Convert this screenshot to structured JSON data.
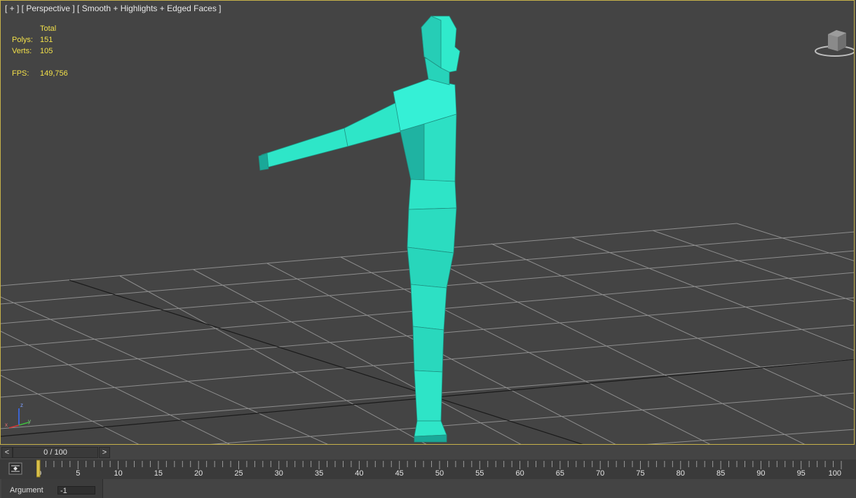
{
  "viewport": {
    "label": "[ + ] [ Perspective ] [ Smooth + Highlights + Edged Faces ]",
    "stats": {
      "header": "Total",
      "polys_label": "Polys:",
      "polys_value": "151",
      "verts_label": "Verts:",
      "verts_value": "105",
      "fps_label": "FPS:",
      "fps_value": "149,756"
    },
    "axes": {
      "x": "x",
      "y": "y",
      "z": "z"
    },
    "colors": {
      "background": "#444444",
      "grid": "#9a9a9a",
      "model": "#2fe6c8",
      "stats_text": "#f2e04a"
    }
  },
  "time_slider": {
    "prev_label": "<",
    "next_label": ">",
    "frame_display": "0 / 100"
  },
  "track_bar": {
    "ticks": [
      "0",
      "5",
      "10",
      "15",
      "20",
      "25",
      "30",
      "35",
      "40",
      "45",
      "50",
      "55",
      "60",
      "65",
      "70",
      "75",
      "80",
      "85",
      "90",
      "95",
      "100"
    ]
  },
  "bottom": {
    "argument_label": "Argument",
    "argument_value": "-1"
  }
}
